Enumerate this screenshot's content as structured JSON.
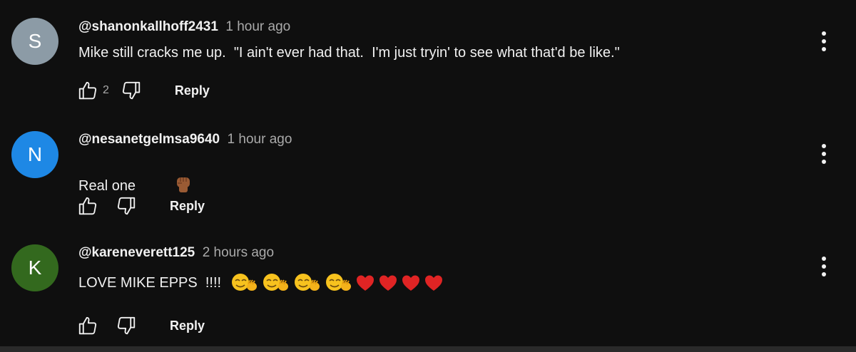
{
  "comments": [
    {
      "avatar_letter": "S",
      "avatar_color": "#8c9ba6",
      "handle": "@shanonkallhoff2431",
      "time": "1 hour ago",
      "text": "Mike still cracks me up.  \"I ain't ever had that.  I'm just tryin' to see what that'd be like.\"",
      "like_count": "2",
      "reply_label": "Reply"
    },
    {
      "avatar_letter": "N",
      "avatar_color": "#1e88e5",
      "handle": "@nesanetgelmsa9640",
      "time": "1 hour ago",
      "text": "Real one",
      "emoji": "raised-fist-medium-dark-skin",
      "like_count": "",
      "reply_label": "Reply"
    },
    {
      "avatar_letter": "K",
      "avatar_color": "#33691e",
      "handle": "@kareneverett125",
      "time": "2 hours ago",
      "text": "LOVE MIKE EPPS  !!!!",
      "emojis": [
        "waving-face",
        "waving-face",
        "waving-face",
        "waving-face",
        "red-heart",
        "red-heart",
        "red-heart",
        "red-heart"
      ],
      "like_count": "",
      "reply_label": "Reply"
    }
  ]
}
